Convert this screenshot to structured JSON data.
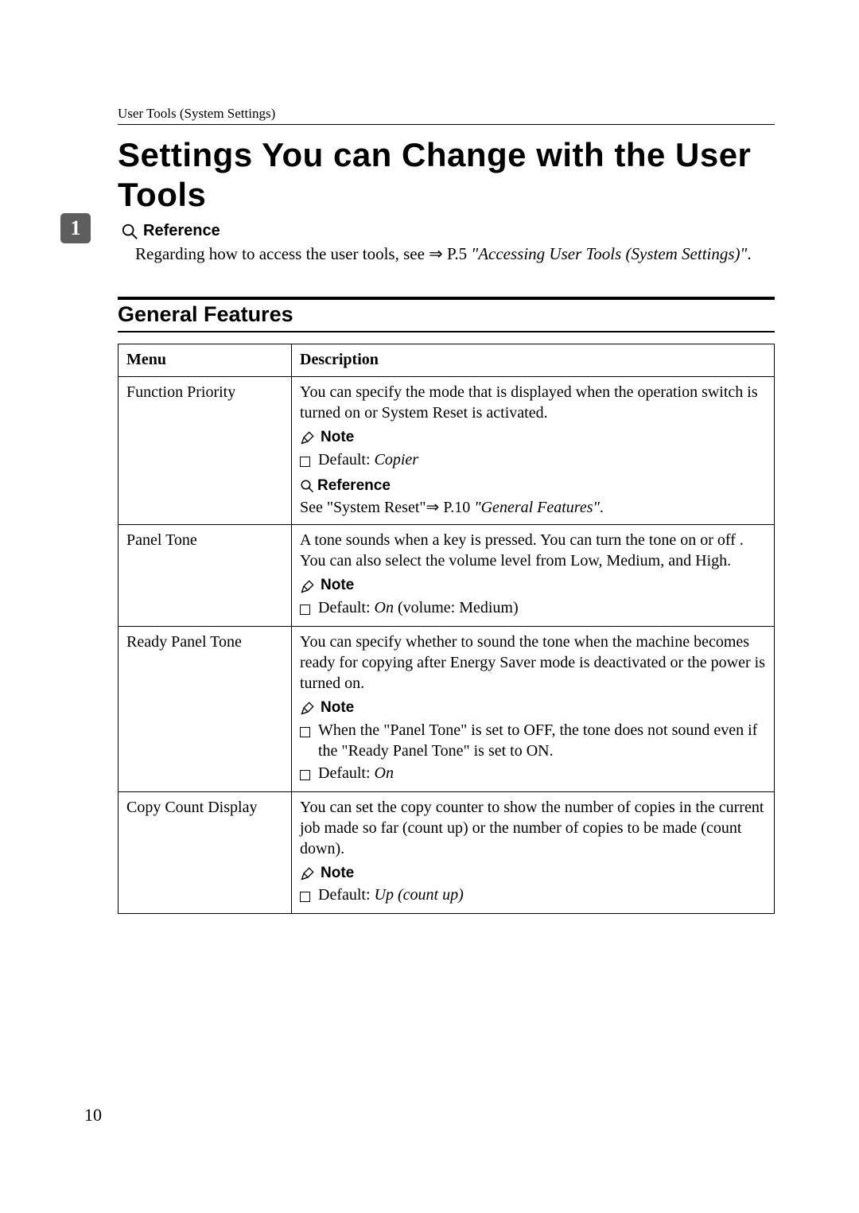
{
  "header": "User Tools (System Settings)",
  "main_title": "Settings You can Change with the User Tools",
  "tab_number": "1",
  "reference": {
    "label": "Reference",
    "text_before": "Regarding how to access the user tools, see ",
    "arrow": "⇒",
    "page_ref": " P.5 ",
    "italic_ref": "\"Accessing User Tools (System Settings)\"",
    "after": "."
  },
  "section_title": "General Features",
  "col_headers": {
    "menu": "Menu",
    "desc": "Description"
  },
  "note_label": "Note",
  "reference_label": "Reference",
  "rows": {
    "function_priority": {
      "menu": "Function Priority",
      "desc": "You can specify the mode that is displayed when the operation switch is turned on or System Reset is activated.",
      "default_prefix": "Default: ",
      "default_value": "Copier",
      "ref_text_before": "See \"System Reset\"",
      "ref_arrow": "⇒",
      "ref_page": " P.10 ",
      "ref_italic": "\"General Features\"",
      "ref_after": "."
    },
    "panel_tone": {
      "menu": "Panel Tone",
      "desc": "A tone sounds when a key is pressed. You can turn the tone on or off . You can also select the volume level from Low, Medium, and High.",
      "default_prefix": "Default: ",
      "default_value": "On",
      "default_suffix": " (volume: Medium)"
    },
    "ready_panel_tone": {
      "menu": "Ready Panel Tone",
      "desc": "You can specify whether to sound the tone when the machine becomes ready for copying after Energy Saver mode is deactivated or the power is turned on.",
      "note1": "When the \"Panel Tone\" is set to OFF, the tone does not sound even if the \"Ready Panel Tone\" is set to ON.",
      "default_prefix": "Default: ",
      "default_value": "On"
    },
    "copy_count": {
      "menu": "Copy Count Display",
      "desc": "You can set the copy counter to show the number of copies in the current job made so far (count up) or the number of copies to be made (count down).",
      "default_prefix": "Default: ",
      "default_value": "Up (count up)"
    }
  },
  "page_number": "10"
}
